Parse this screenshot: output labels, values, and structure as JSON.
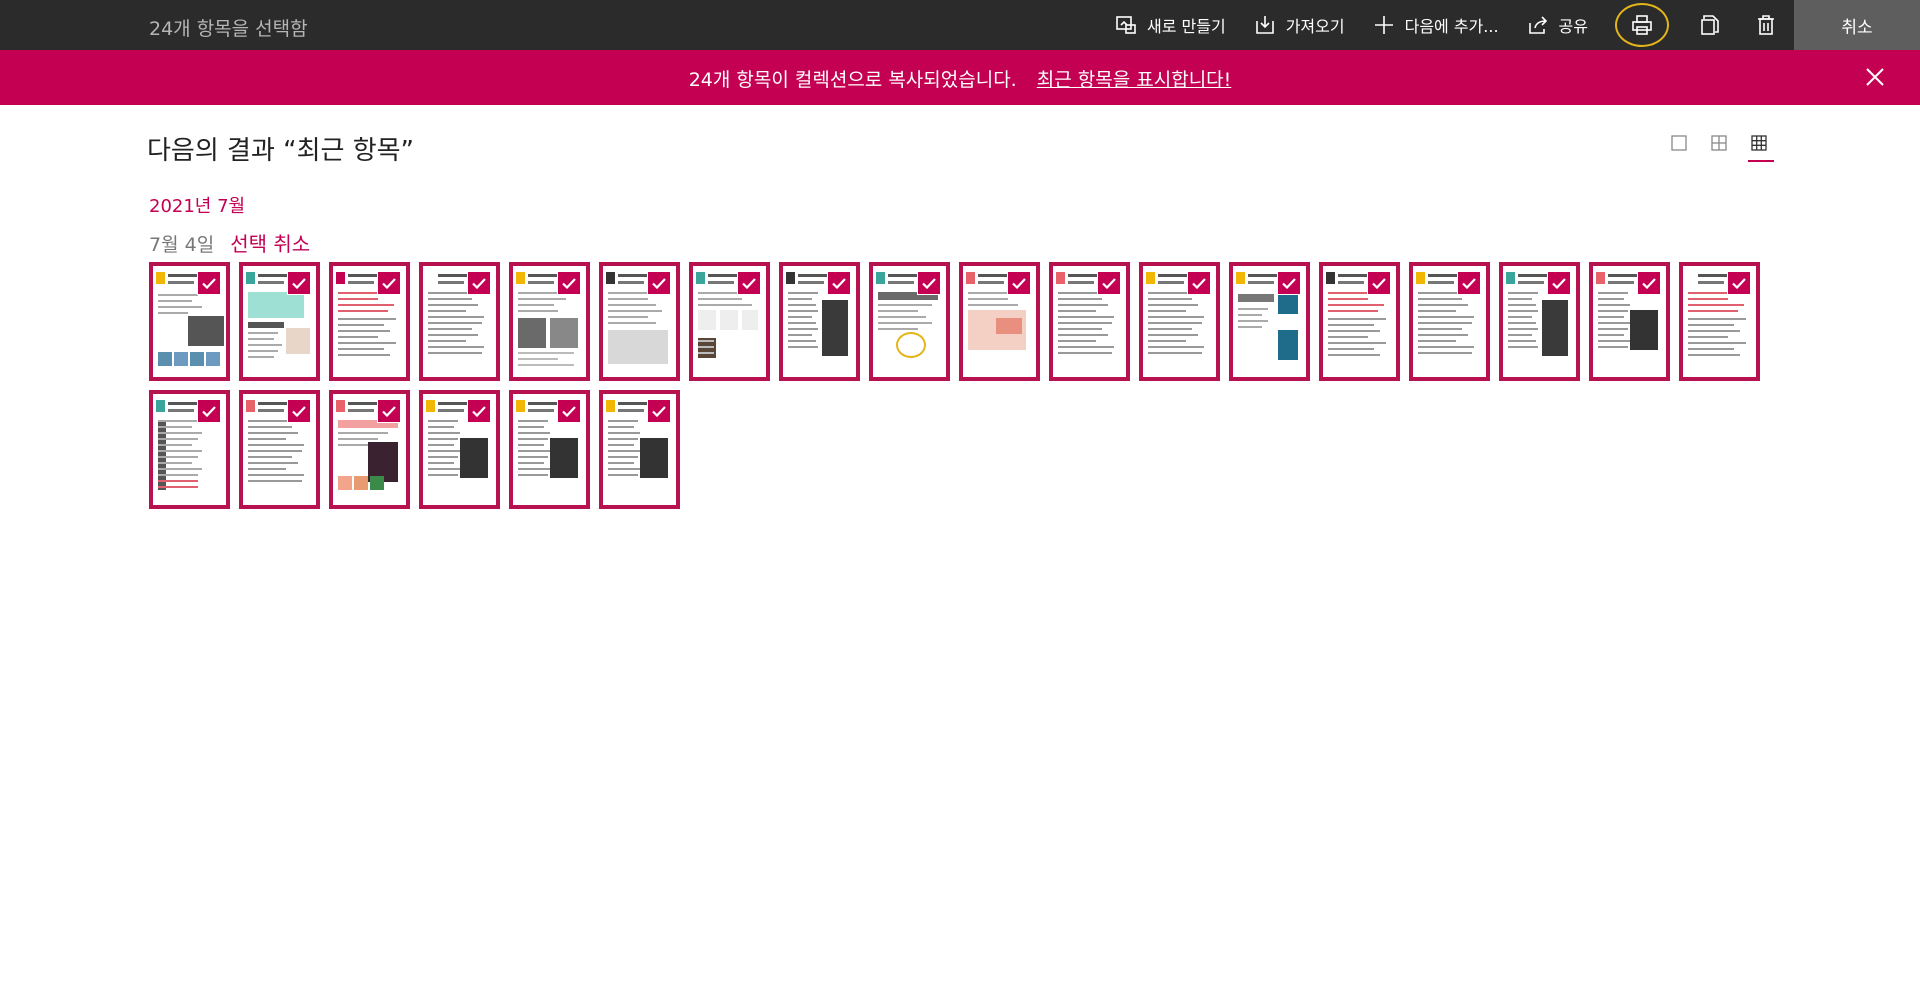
{
  "topbar": {
    "selection_title": "24개 항목을 선택함",
    "buttons": {
      "create_new": "새로 만들기",
      "import": "가져오기",
      "add_to": "다음에 추가...",
      "share": "공유"
    },
    "cancel": "취소"
  },
  "banner": {
    "message": "24개 항목이 컬렉션으로 복사되었습니다.",
    "link": "최근 항목을 표시합니다!",
    "color": "#c30052"
  },
  "main": {
    "result_title": "다음의 결과 “최근 항목”",
    "view_modes": [
      "single-view-icon",
      "medium-grid-icon",
      "small-grid-icon"
    ],
    "active_view_mode": "small-grid-icon",
    "month": "2021년 7월",
    "day": "7월 4일",
    "deselect": "선택 취소"
  },
  "thumbnails": [
    {
      "badge": "#f2b705",
      "style": "photos"
    },
    {
      "badge": "#3aa59a",
      "style": "mint"
    },
    {
      "badge": "#c30052",
      "style": "text-red"
    },
    {
      "badge": "#ffffff",
      "style": "text"
    },
    {
      "badge": "#f2b705",
      "style": "photos2"
    },
    {
      "badge": "#333333",
      "style": "grey-block"
    },
    {
      "badge": "#3aa59a",
      "style": "columns"
    },
    {
      "badge": "#333333",
      "style": "dark-side"
    },
    {
      "badge": "#3aa59a",
      "style": "circle"
    },
    {
      "badge": "#e8626a",
      "style": "pink"
    },
    {
      "badge": "#e8626a",
      "style": "text"
    },
    {
      "badge": "#f2b705",
      "style": "text"
    },
    {
      "badge": "#f2b705",
      "style": "blue-photo"
    },
    {
      "badge": "#333333",
      "style": "text-red"
    },
    {
      "badge": "#f2b705",
      "style": "text"
    },
    {
      "badge": "#3aa59a",
      "style": "dark-side"
    },
    {
      "badge": "#e8626a",
      "style": "dark-right"
    },
    {
      "badge": "#ffffff",
      "style": "text-red"
    },
    {
      "badge": "#3aa59a",
      "style": "toolbar"
    },
    {
      "badge": "#e8626a",
      "style": "text"
    },
    {
      "badge": "#e8626a",
      "style": "menu"
    },
    {
      "badge": "#f2b705",
      "style": "dark-right"
    },
    {
      "badge": "#f2b705",
      "style": "dark-right"
    },
    {
      "badge": "#f2b705",
      "style": "dark-right"
    }
  ]
}
